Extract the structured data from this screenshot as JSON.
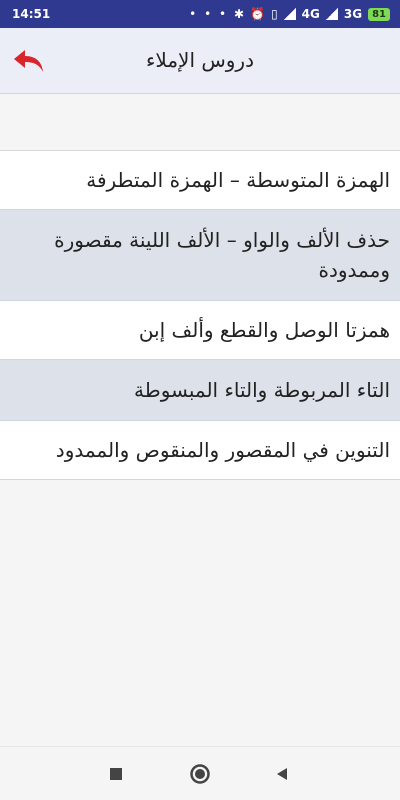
{
  "status_bar": {
    "time": "14:51",
    "dots": "• • •",
    "network_4g": "4G",
    "network_3g": "3G",
    "battery": "81"
  },
  "header": {
    "title": "دروس الإملاء"
  },
  "lessons": [
    {
      "label": "الهمزة المتوسطة – الهمزة المتطرفة"
    },
    {
      "label": "حذف الألف والواو – الألف اللينة مقصورة وممدودة"
    },
    {
      "label": "همزتا الوصل والقطع وألف إبن"
    },
    {
      "label": "التاء المربوطة والتاء المبسوطة"
    },
    {
      "label": "التنوين في المقصور والمنقوص والممدود"
    }
  ],
  "colors": {
    "status_bar": "#2f3990",
    "header_bg": "#eceef7",
    "back_arrow": "#d9262c",
    "row_alt": "#dde2ea"
  },
  "icons": {
    "back": "reply-arrow-icon",
    "nav_recent": "square-icon",
    "nav_home": "circle-icon",
    "nav_back": "triangle-left-icon"
  }
}
